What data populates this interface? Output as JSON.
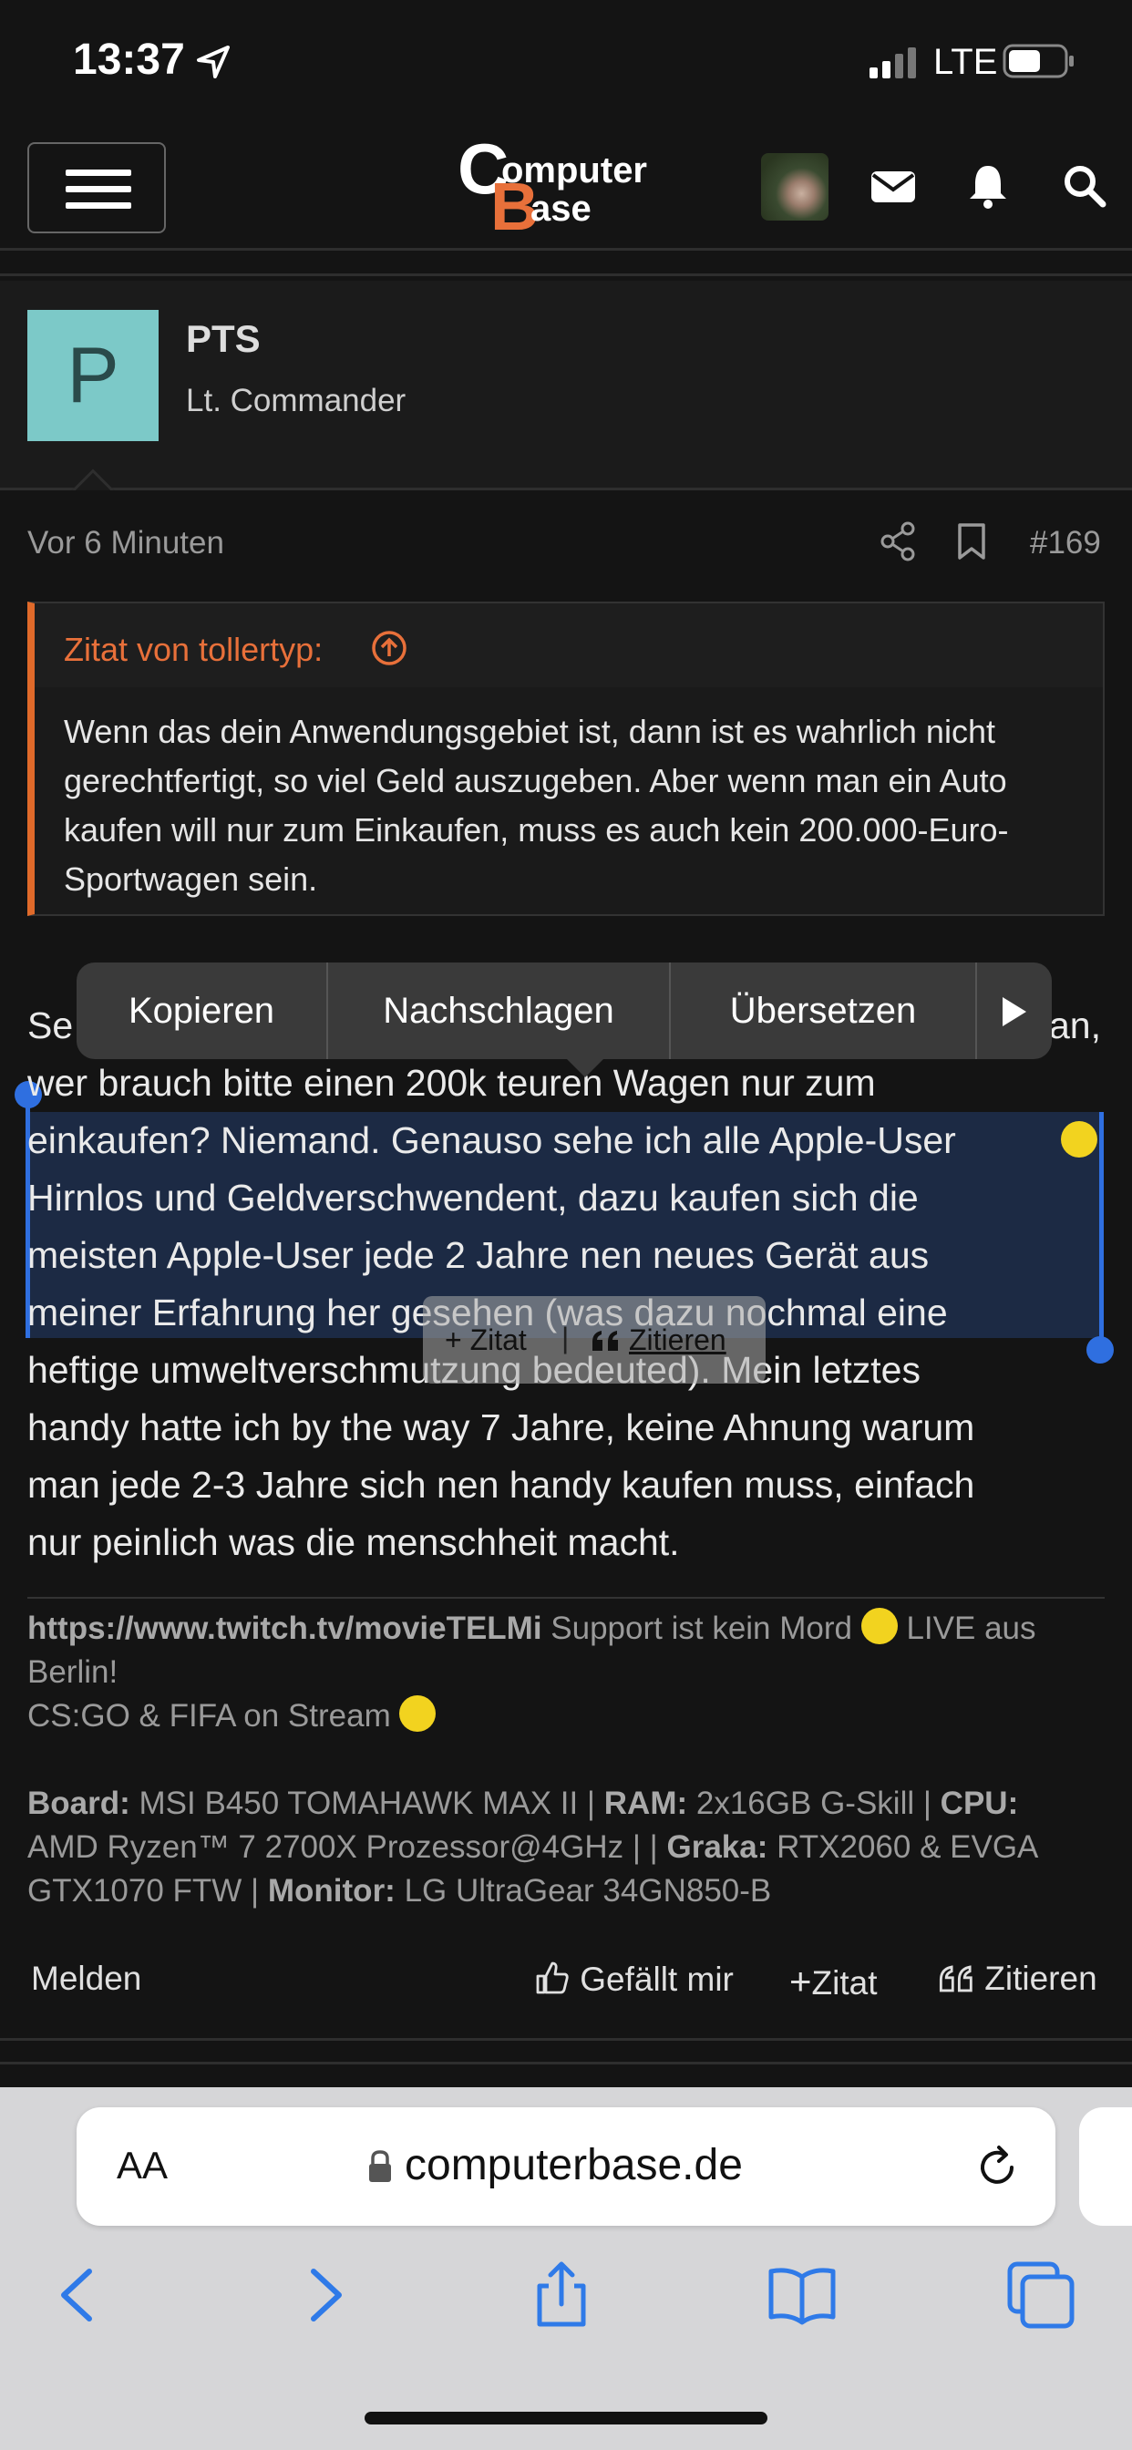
{
  "status_bar": {
    "time": "13:37",
    "network": "LTE"
  },
  "header": {
    "logo": "Computer Base"
  },
  "post": {
    "author": {
      "initial": "P",
      "name": "PTS",
      "rank": "Lt. Commander"
    },
    "time": "Vor 6 Minuten",
    "number": "#169",
    "quote": {
      "title": "Zitat von tollertyp:",
      "text": "Wenn das dein Anwendungsgebiet ist, dann ist es wahrlich nicht gerechtfertigt, so viel Geld auszugeben. Aber wenn man ein Auto kaufen will nur zum Einkaufen, muss es auch kein 200.000-Euro-Sportwagen sein."
    },
    "body": {
      "l1a": "Se",
      "l1b": "an,",
      "l2": "wer brauch bitte einen 200k teuren Wagen nur zum",
      "l3": "einkaufen? Niemand. Genauso sehe ich alle Apple-User",
      "l4": "Hirnlos und Geldverschwendent, dazu kaufen sich die",
      "l5": "meisten Apple-User jede 2 Jahre nen neues Gerät aus",
      "l6": "meiner Erfahrung her gesehen (was dazu nochmal eine",
      "l7": "heftige umweltverschmutzung bedeuted). Mein letztes",
      "l8": "handy hatte ich by the way 7 Jahre, keine Ahnung warum",
      "l9": "man jede 2-3 Jahre sich nen handy kaufen muss, einfach",
      "l10": "nur peinlich was die menschheit macht."
    },
    "signature": {
      "link": "https://www.twitch.tv/movieTELMi",
      "line1_rest": "Support ist kein Mord",
      "line1_tail": "LIVE aus",
      "line2": "Berlin!",
      "line3": "CS:GO & FIFA on Stream",
      "board_label": "Board:",
      "board": "MSI B450 TOMAHAWK MAX II |",
      "ram_label": "RAM:",
      "ram": "2x16GB G-Skill |",
      "cpu_label": "CPU:",
      "cpu": "AMD Ryzen™ 7 2700X Prozessor@4GHz | |",
      "graka_label": "Graka:",
      "graka": "RTX2060 & EVGA",
      "graka2": "GTX1070 FTW |",
      "monitor_label": "Monitor:",
      "monitor": "LG UltraGear 34GN850-B"
    },
    "actions": {
      "report": "Melden",
      "like": "Gefällt mir",
      "quote": "Zitat",
      "cite": "Zitieren"
    }
  },
  "context_menu": {
    "copy": "Kopieren",
    "lookup": "Nachschlagen",
    "translate": "Übersetzen"
  },
  "quote_tool": {
    "quote": "+ Zitat",
    "cite": "Zitieren"
  },
  "browser": {
    "aa": "AA",
    "url": "computerbase.de"
  }
}
